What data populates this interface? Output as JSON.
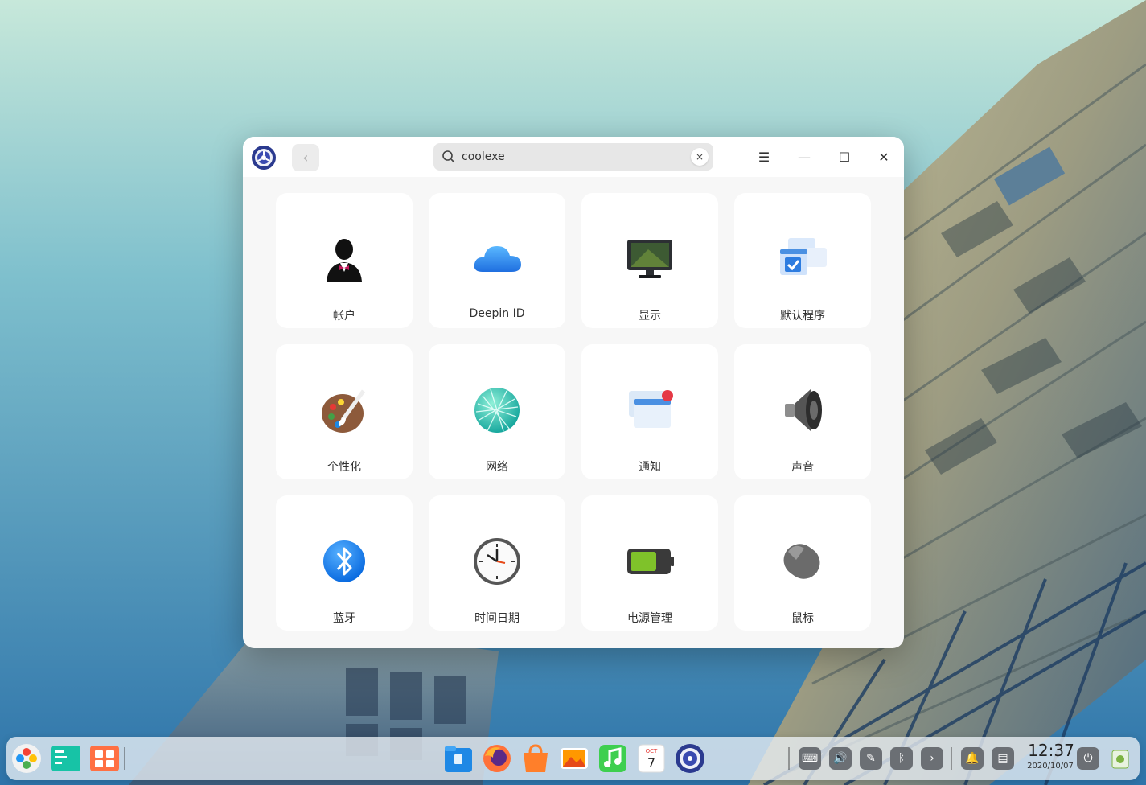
{
  "window": {
    "search_value": "coolexe",
    "back_label": "‹",
    "clear_label": "×",
    "menu_label": "☰",
    "minimize_label": "—",
    "maximize_label": "☐",
    "close_label": "✕"
  },
  "modules": [
    {
      "label": "帐户",
      "icon": "account-icon"
    },
    {
      "label": "Deepin ID",
      "icon": "cloud-icon"
    },
    {
      "label": "显示",
      "icon": "display-icon"
    },
    {
      "label": "默认程序",
      "icon": "default-apps-icon"
    },
    {
      "label": "个性化",
      "icon": "palette-icon"
    },
    {
      "label": "网络",
      "icon": "network-globe-icon"
    },
    {
      "label": "通知",
      "icon": "notification-icon"
    },
    {
      "label": "声音",
      "icon": "speaker-icon"
    },
    {
      "label": "蓝牙",
      "icon": "bluetooth-icon"
    },
    {
      "label": "时间日期",
      "icon": "clock-icon"
    },
    {
      "label": "电源管理",
      "icon": "battery-icon"
    },
    {
      "label": "鼠标",
      "icon": "mouse-icon"
    }
  ],
  "dock": {
    "calendar_month": "OCT",
    "calendar_day": "7",
    "clock_time": "12:37",
    "clock_date": "2020/10/07"
  },
  "colors": {
    "accent": "#2d8cf0",
    "window_bg": "#f7f7f7",
    "tile_bg": "#ffffff"
  }
}
